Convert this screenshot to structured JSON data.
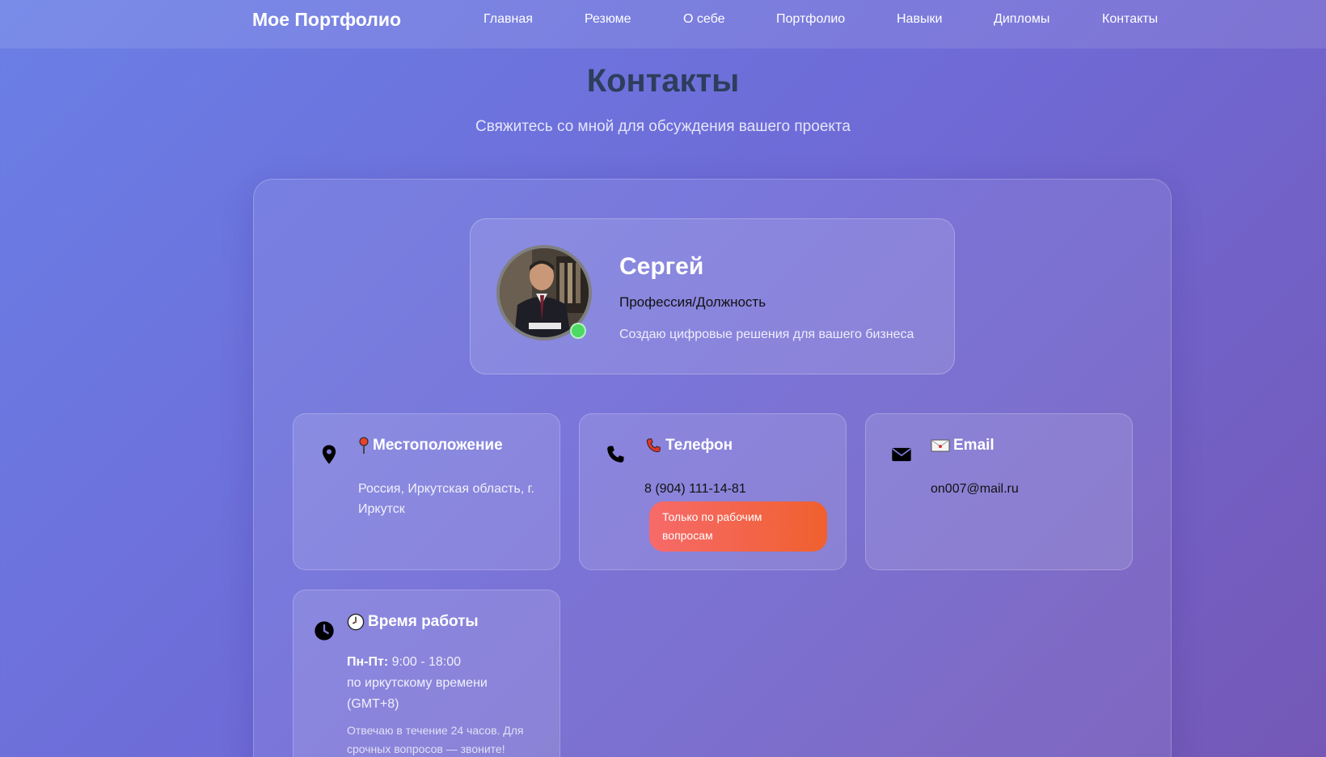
{
  "header": {
    "logo": "Мое Портфолио",
    "nav": [
      "Главная",
      "Резюме",
      "О себе",
      "Портфолио",
      "Навыки",
      "Дипломы",
      "Контакты"
    ]
  },
  "page": {
    "title": "Контакты",
    "subtitle": "Свяжитесь со мной для обсуждения вашего проекта"
  },
  "profile": {
    "name": "Сергей",
    "role": "Профессия/Должность",
    "tagline": "Создаю цифровые решения для вашего бизнеса",
    "status_color": "#4cd964"
  },
  "cards": {
    "location": {
      "icon": "map-pin-icon",
      "title": "Местоположение",
      "text": "Россия, Иркутская область, г. Иркутск"
    },
    "phone": {
      "icon": "phone-icon",
      "title": "Телефон",
      "text": "8 (904) 111-14-81",
      "badge": "Только по рабочим вопросам"
    },
    "email": {
      "icon": "envelope-icon",
      "title": "Email",
      "text": "on007@mail.ru"
    },
    "hours": {
      "icon": "clock-icon",
      "title": "Время работы",
      "days_label": "Пн-Пт:",
      "time": "9:00 - 18:00",
      "timezone_line1": "по иркутскому времени",
      "timezone_line2": "(GMT+8)",
      "note": "Отвечаю в течение 24 часов. Для срочных вопросов — звоните!"
    }
  },
  "colors": {
    "accent_title": "#2c3e5c",
    "badge_gradient_start": "#f66a6a",
    "badge_gradient_end": "#f0602e"
  }
}
